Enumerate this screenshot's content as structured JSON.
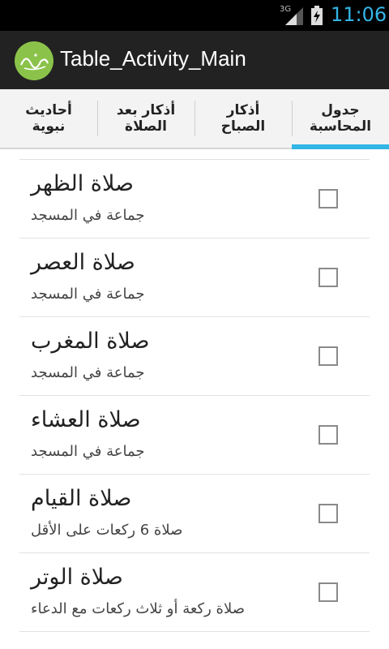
{
  "status_bar": {
    "network": "3G",
    "time": "11:06"
  },
  "action_bar": {
    "app_icon": "app-logo-calligraphy-icon",
    "title": "Table_Activity_Main"
  },
  "tabs": [
    {
      "label": "أحاديث\nنبوية",
      "selected": false
    },
    {
      "label": "أذكار بعد\nالصلاة",
      "selected": false
    },
    {
      "label": "أذكار\nالصباح",
      "selected": false
    },
    {
      "label": "جدول\nالمحاسبة",
      "selected": true
    }
  ],
  "list": {
    "items": [
      {
        "title": "صلاة الظهر",
        "subtitle": "جماعة في المسجد",
        "checked": false
      },
      {
        "title": "صلاة العصر",
        "subtitle": "جماعة في المسجد",
        "checked": false
      },
      {
        "title": "صلاة المغرب",
        "subtitle": "جماعة في المسجد",
        "checked": false
      },
      {
        "title": "صلاة العشاء",
        "subtitle": "جماعة في المسجد",
        "checked": false
      },
      {
        "title": "صلاة القيام",
        "subtitle": "صلاة 6 ركعات على الأقل",
        "checked": false
      },
      {
        "title": "صلاة الوتر",
        "subtitle": "صلاة ركعة أو ثلاث ركعات مع الدعاء",
        "checked": false
      }
    ]
  },
  "colors": {
    "accent": "#33b5e5",
    "action_bar": "#222222",
    "app_icon": "#8bc34a"
  }
}
